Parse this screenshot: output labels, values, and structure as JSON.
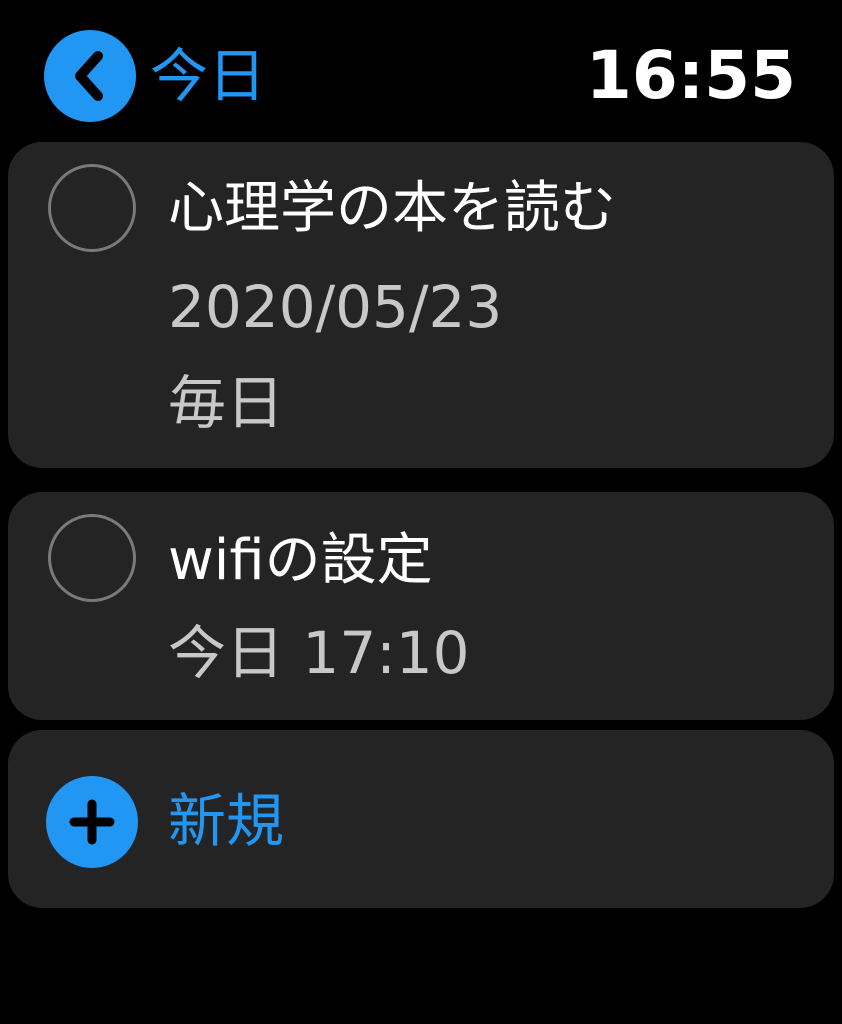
{
  "header": {
    "back_label": "今日",
    "time": "16:55"
  },
  "reminders": [
    {
      "title": "心理学の本を読む",
      "date": "2020/05/23",
      "repeat": "毎日"
    },
    {
      "title": "wifiの設定",
      "due": "今日 17:10"
    }
  ],
  "new_item": {
    "label": "新規"
  },
  "colors": {
    "accent": "#2196f3",
    "background": "#000000",
    "card": "#242424",
    "subtext": "#c8c8c8",
    "circle_border": "#7a7a7a"
  },
  "icons": {
    "back": "chevron-left-icon",
    "add": "plus-icon",
    "checkbox": "empty-circle-icon"
  }
}
